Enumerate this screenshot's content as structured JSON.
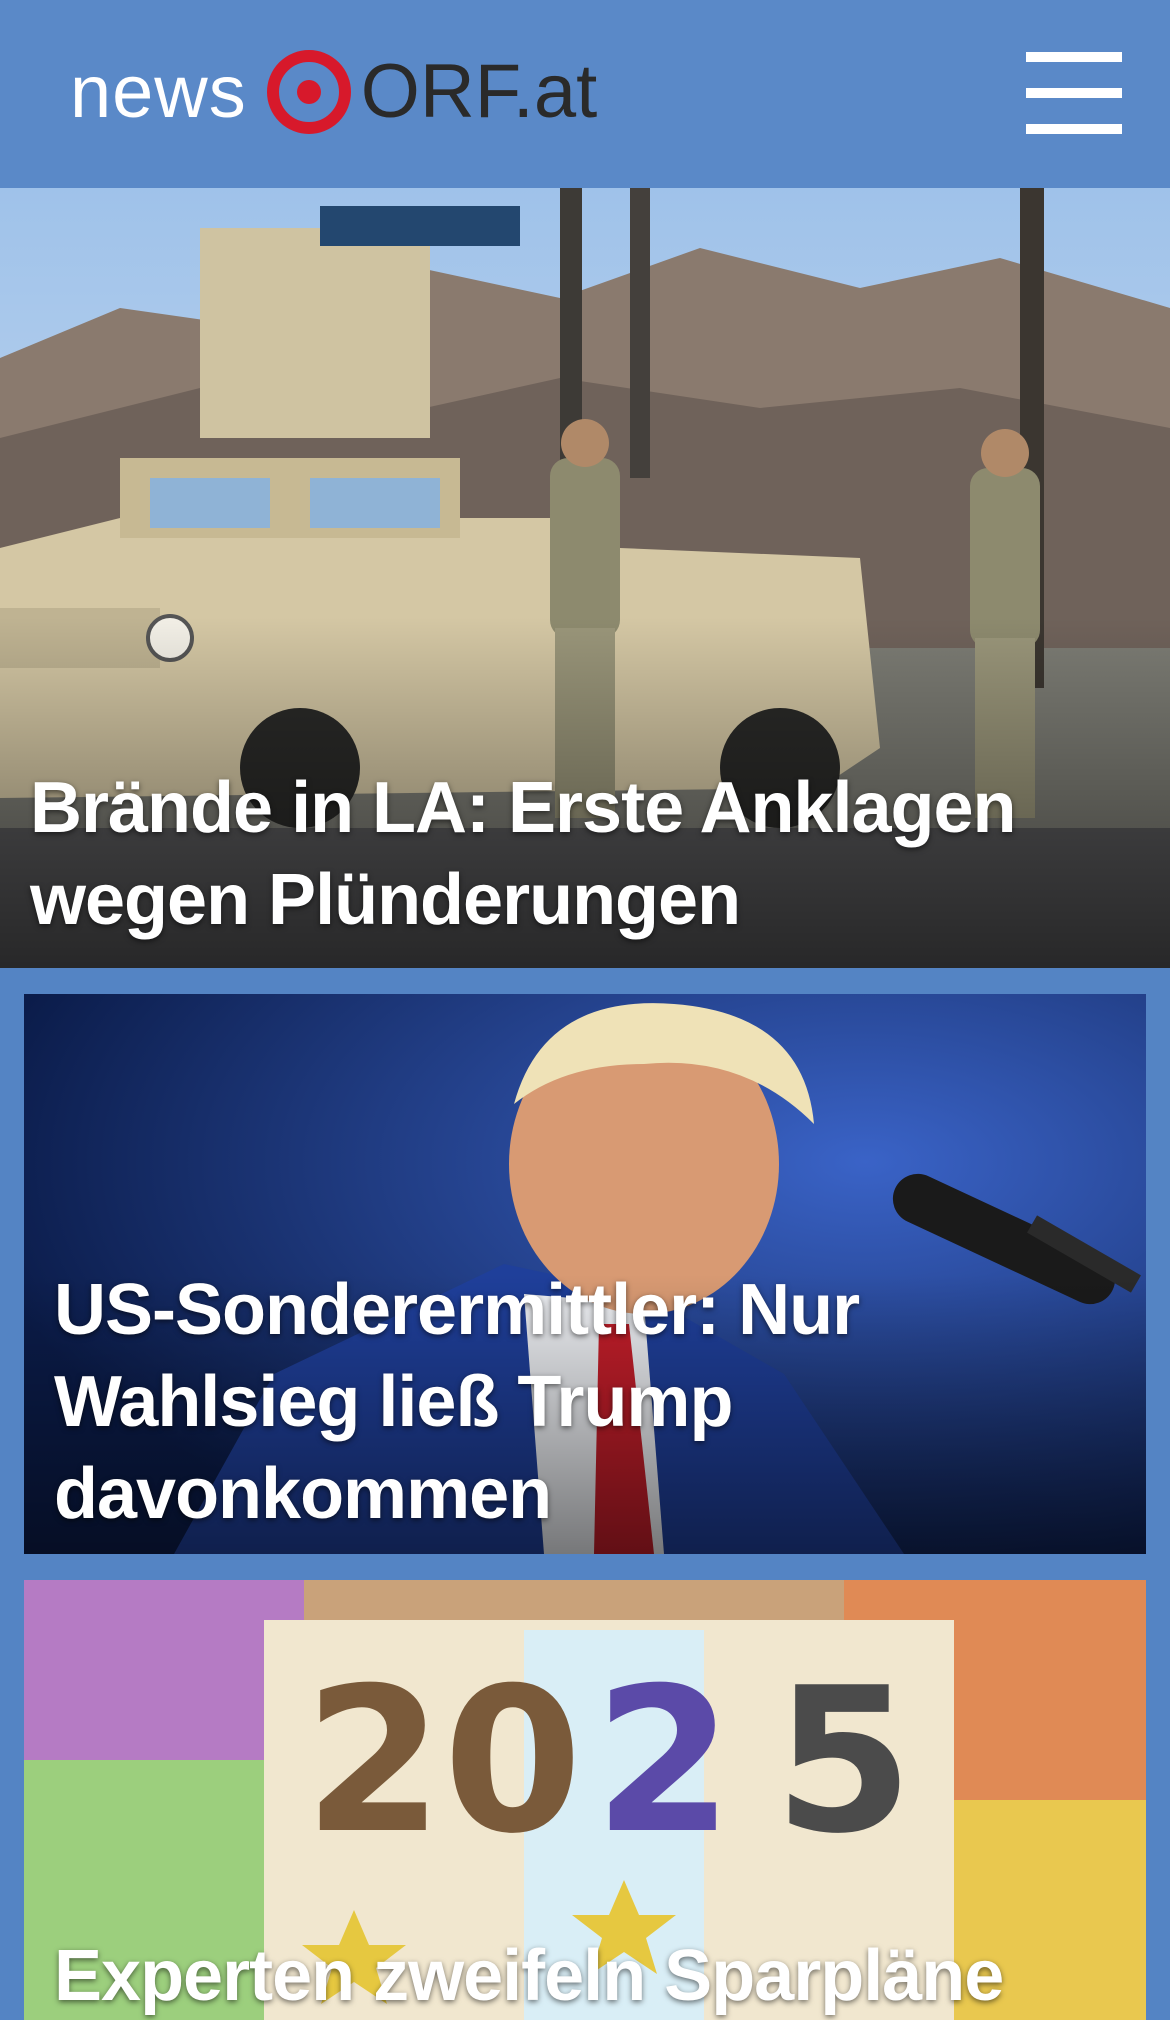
{
  "header": {
    "logo_news": "news",
    "logo_orf": "ORF.at",
    "menu_icon": "hamburger-menu-icon",
    "background_color": "#5a89c8",
    "logo_accent_color": "#d7192b"
  },
  "stories": [
    {
      "headline": "Brände in LA: Erste Anklagen wegen Plünderungen",
      "image_description_icon": "military-humvee-soldiers-photo"
    },
    {
      "headline": "US-Sonderermittler: Nur Wahlsieg ließ Trump davonkommen",
      "image_description_icon": "portrait-speaker-microphone-photo"
    },
    {
      "headline": "Experten zweifeln Sparpläne von",
      "image_description_icon": "euro-banknotes-2025-photo"
    }
  ],
  "page_background": "#5484c4"
}
